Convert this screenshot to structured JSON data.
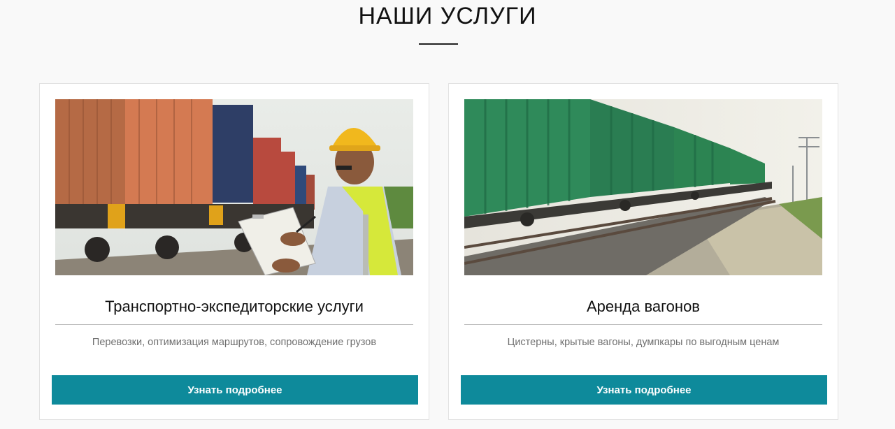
{
  "section": {
    "title": "НАШИ УСЛУГИ"
  },
  "cards": [
    {
      "title": "Транспортно-экспедиторские услуги",
      "description": "Перевозки, оптимизация маршрутов, сопровождение грузов",
      "button_label": "Узнать подробнее"
    },
    {
      "title": "Аренда вагонов",
      "description": "Цистерны, крытые вагоны, думпкары по выгодным ценам",
      "button_label": "Узнать подробнее"
    }
  ],
  "colors": {
    "accent": "#0e8a9b",
    "background": "#f9f9f9",
    "card": "#ffffff"
  }
}
